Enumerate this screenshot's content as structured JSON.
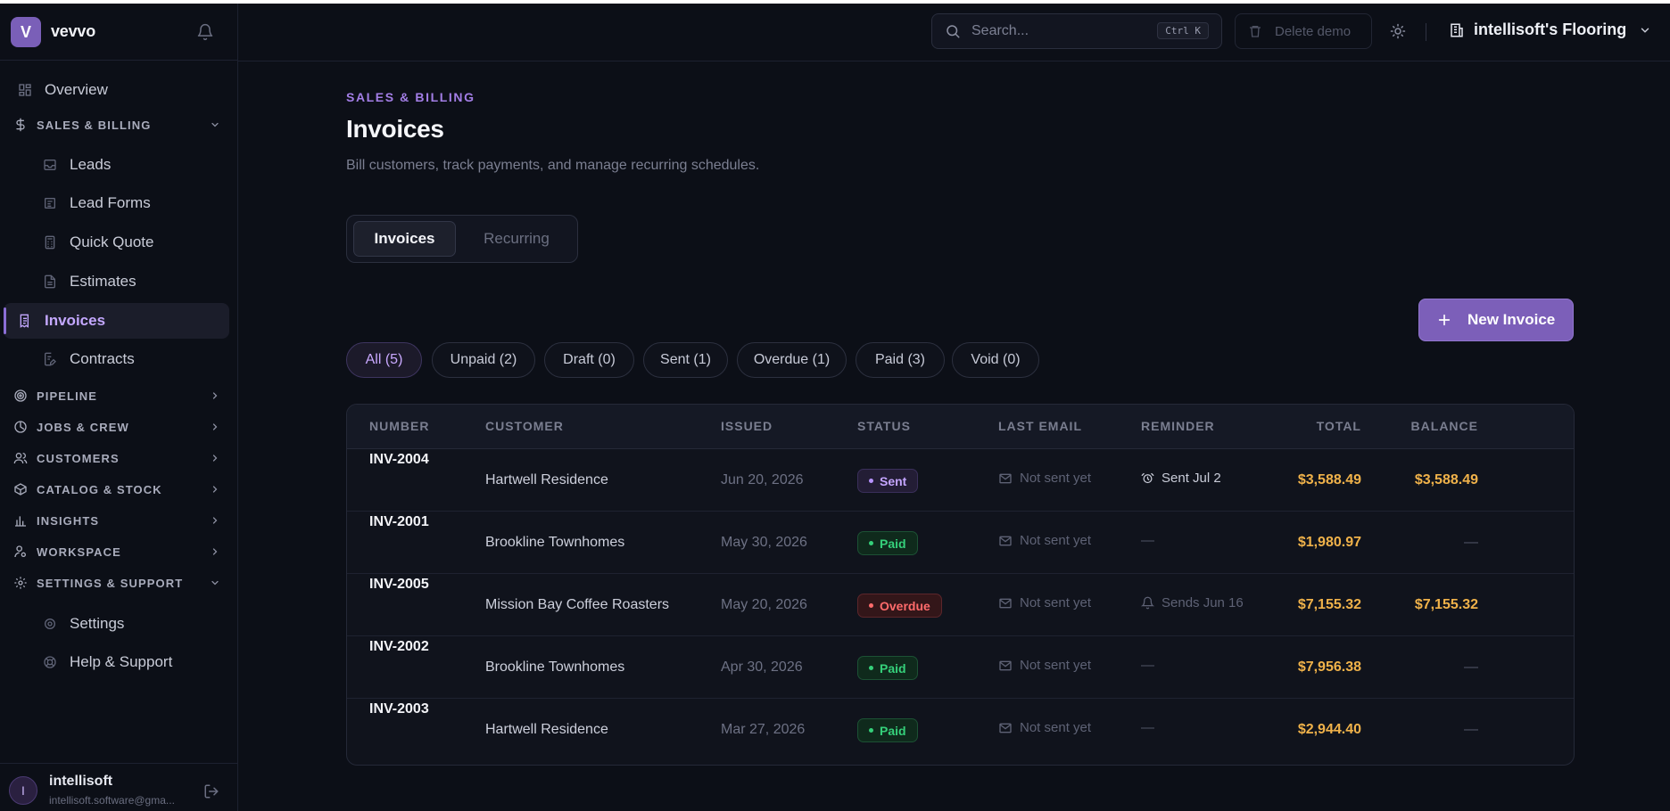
{
  "app": {
    "logo_letter": "V",
    "name": "vevvo"
  },
  "sidebar": {
    "overview": "Overview",
    "sales_billing": {
      "label": "SALES & BILLING",
      "items": [
        "Leads",
        "Lead Forms",
        "Quick Quote",
        "Estimates",
        "Invoices",
        "Contracts"
      ]
    },
    "sections": [
      "PIPELINE",
      "JOBS & CREW",
      "CUSTOMERS",
      "CATALOG & STOCK",
      "INSIGHTS",
      "WORKSPACE"
    ],
    "settings_support": {
      "label": "SETTINGS & SUPPORT",
      "items": [
        "Settings",
        "Help & Support"
      ]
    },
    "user": {
      "initial": "I",
      "name": "intellisoft",
      "email": "intellisoft.software@gma..."
    }
  },
  "topbar": {
    "search_placeholder": "Search...",
    "search_shortcut": "Ctrl K",
    "delete_demo": "Delete demo",
    "org_name": "intellisoft's Flooring"
  },
  "page": {
    "eyebrow": "SALES & BILLING",
    "title": "Invoices",
    "subtitle": "Bill customers, track payments, and manage recurring schedules.",
    "tabs": [
      "Invoices",
      "Recurring"
    ],
    "new_button": "New Invoice",
    "filters": [
      "All (5)",
      "Unpaid (2)",
      "Draft (0)",
      "Sent (1)",
      "Overdue (1)",
      "Paid (3)",
      "Void (0)"
    ]
  },
  "table": {
    "columns": [
      "NUMBER",
      "CUSTOMER",
      "ISSUED",
      "STATUS",
      "LAST EMAIL",
      "REMINDER",
      "TOTAL",
      "BALANCE"
    ],
    "rows": [
      {
        "number": "INV-2004",
        "customer": "Hartwell Residence",
        "issued": "Jun 20, 2026",
        "status": "Sent",
        "last_email": "Not sent yet",
        "reminder": "Sent Jul 2",
        "total": "$3,588.49",
        "balance": "$3,588.49"
      },
      {
        "number": "INV-2001",
        "customer": "Brookline Townhomes",
        "issued": "May 30, 2026",
        "status": "Paid",
        "last_email": "Not sent yet",
        "reminder": "—",
        "total": "$1,980.97",
        "balance": "—"
      },
      {
        "number": "INV-2005",
        "customer": "Mission Bay Coffee Roasters",
        "issued": "May 20, 2026",
        "status": "Overdue",
        "last_email": "Not sent yet",
        "reminder": "Sends Jun 16",
        "total": "$7,155.32",
        "balance": "$7,155.32"
      },
      {
        "number": "INV-2002",
        "customer": "Brookline Townhomes",
        "issued": "Apr 30, 2026",
        "status": "Paid",
        "last_email": "Not sent yet",
        "reminder": "—",
        "total": "$7,956.38",
        "balance": "—"
      },
      {
        "number": "INV-2003",
        "customer": "Hartwell Residence",
        "issued": "Mar 27, 2026",
        "status": "Paid",
        "last_email": "Not sent yet",
        "reminder": "—",
        "total": "$2,944.40",
        "balance": "—"
      }
    ]
  },
  "colors": {
    "accent": "#7c5fb9",
    "accent_text": "#a37ee6",
    "amount": "#f0b24a",
    "paid": "#35d07a",
    "overdue": "#ff6b6b",
    "background": "#0c0f17"
  }
}
